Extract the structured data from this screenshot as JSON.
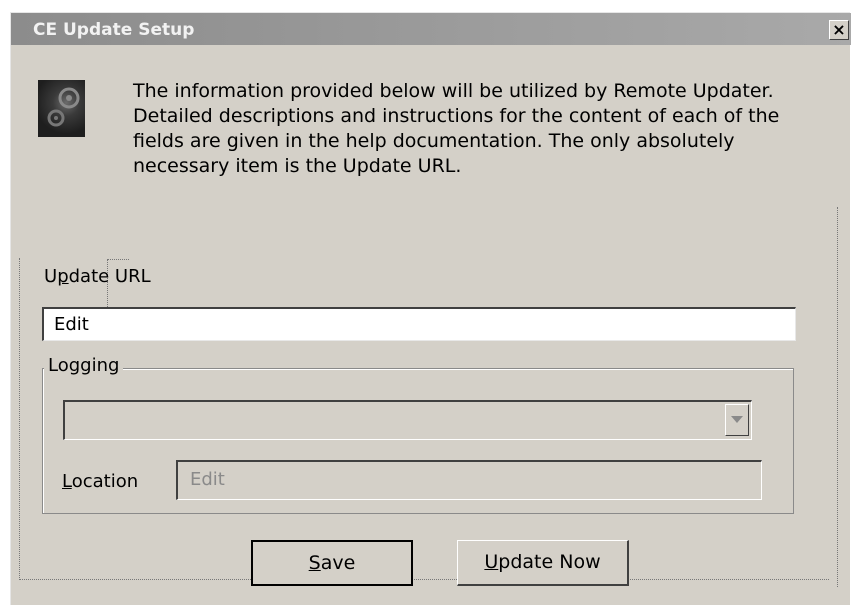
{
  "window": {
    "title": "CE Update Setup",
    "close_glyph": "✕",
    "icon": "app-gears-icon"
  },
  "info": {
    "text": "The information provided below will be utilized by Remote Updater. Detailed descriptions and instructions for the content of each of the fields are given in the help documentation. The only absolutely necessary item is the Update URL."
  },
  "update_url": {
    "label_pre": "U",
    "label_mnemonic": "p",
    "label_post": "date URL",
    "value": "Edit"
  },
  "logging": {
    "legend": "Logging",
    "combo_value": "",
    "location_label_mnemonic": "L",
    "location_label_post": "ocation",
    "location_value": "Edit"
  },
  "buttons": {
    "save_mnemonic": "S",
    "save_post": "ave",
    "update_mnemonic": "U",
    "update_post": "pdate Now"
  }
}
